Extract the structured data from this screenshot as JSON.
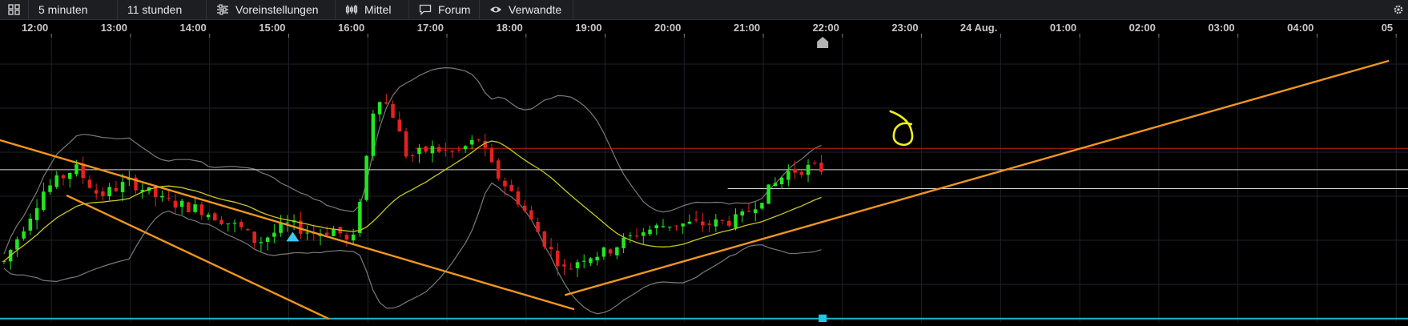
{
  "toolbar": {
    "icons": [
      "grid-icon",
      "sliders-icon",
      "candles-icon",
      "chat-icon",
      "eye-icon",
      "gear-icon"
    ],
    "items": [
      {
        "label": "5 minuten"
      },
      {
        "label": "11 stunden"
      },
      {
        "label": "Voreinstellungen",
        "icon": "sliders-icon"
      },
      {
        "label": "Mittel",
        "icon": "candles-icon"
      },
      {
        "label": "Forum",
        "icon": "chat-icon"
      },
      {
        "label": "Verwandte",
        "icon": "eye-icon"
      }
    ]
  },
  "colors": {
    "background": "#000000",
    "grid": "#1e2228",
    "up": "#22e622",
    "down": "#e62020",
    "ma": "#c8c81e",
    "bands": "#7a7a7a",
    "trend": "#f0961e",
    "resistance": "#c81e1e",
    "level": "#d8d8d8",
    "baseline": "#1eb4c8",
    "annotation": "#f0f01e"
  },
  "chart_data": {
    "type": "candlestick",
    "interval": "5 minuten",
    "range": "11 stunden",
    "time_ticks": [
      "12:00",
      "13:00",
      "14:00",
      "15:00",
      "16:00",
      "17:00",
      "18:00",
      "19:00",
      "20:00",
      "21:00",
      "22:00",
      "23:00",
      "24 Aug.",
      "01:00",
      "02:00",
      "03:00",
      "04:00",
      "05"
    ],
    "time_domain": [
      11.35,
      29.15
    ],
    "price_domain": [
      0,
      100
    ],
    "price_axis_labels": "not visible",
    "overlays": [
      "moving average (yellow)",
      "Bollinger bands (grey)",
      "orange trend lines",
      "horizontal levels"
    ],
    "candles_note": "relative price level 0-100 (price axis not visible)",
    "anchors": [
      [
        11.4,
        18
      ],
      [
        11.9,
        48
      ],
      [
        12.3,
        58
      ],
      [
        12.6,
        46
      ],
      [
        13.0,
        52
      ],
      [
        13.4,
        44
      ],
      [
        13.9,
        40
      ],
      [
        14.4,
        32
      ],
      [
        14.6,
        26
      ],
      [
        15.0,
        34
      ],
      [
        15.3,
        30
      ],
      [
        15.6,
        32
      ],
      [
        15.8,
        24
      ],
      [
        16.0,
        66
      ],
      [
        16.1,
        90
      ],
      [
        16.3,
        82
      ],
      [
        16.5,
        62
      ],
      [
        16.8,
        66
      ],
      [
        17.1,
        64
      ],
      [
        17.4,
        70
      ],
      [
        17.6,
        56
      ],
      [
        17.9,
        44
      ],
      [
        18.2,
        28
      ],
      [
        18.5,
        14
      ],
      [
        18.7,
        20
      ],
      [
        19.0,
        22
      ],
      [
        19.4,
        30
      ],
      [
        19.8,
        34
      ],
      [
        20.3,
        34
      ],
      [
        20.7,
        36
      ],
      [
        21.0,
        46
      ],
      [
        21.3,
        56
      ],
      [
        21.6,
        58
      ],
      [
        21.75,
        57
      ]
    ],
    "trend_lines": [
      {
        "from": [
          11.3,
          70
        ],
        "to": [
          18.6,
          -2
        ]
      },
      {
        "from": [
          12.2,
          46
        ],
        "to": [
          15.5,
          -6
        ]
      },
      {
        "from": [
          18.5,
          4
        ],
        "to": [
          28.9,
          103
        ]
      }
    ],
    "levels": [
      {
        "y": 66,
        "from": 16.6,
        "to": 29.2,
        "role": "resistance"
      },
      {
        "y": 57,
        "from": 11.35,
        "to": 29.2,
        "role": "level"
      },
      {
        "y": 49,
        "from": 20.55,
        "to": 29.2,
        "role": "level"
      },
      {
        "y": -6,
        "from": 11.35,
        "to": 29.2,
        "role": "baseline"
      }
    ],
    "markers": [
      {
        "type": "triangle-up",
        "x": 15.05,
        "y": 28
      },
      {
        "type": "square",
        "x": 21.75,
        "y": -6
      }
    ],
    "current_time_marker": 21.75,
    "annotation": "handwritten circle near 22:50"
  }
}
